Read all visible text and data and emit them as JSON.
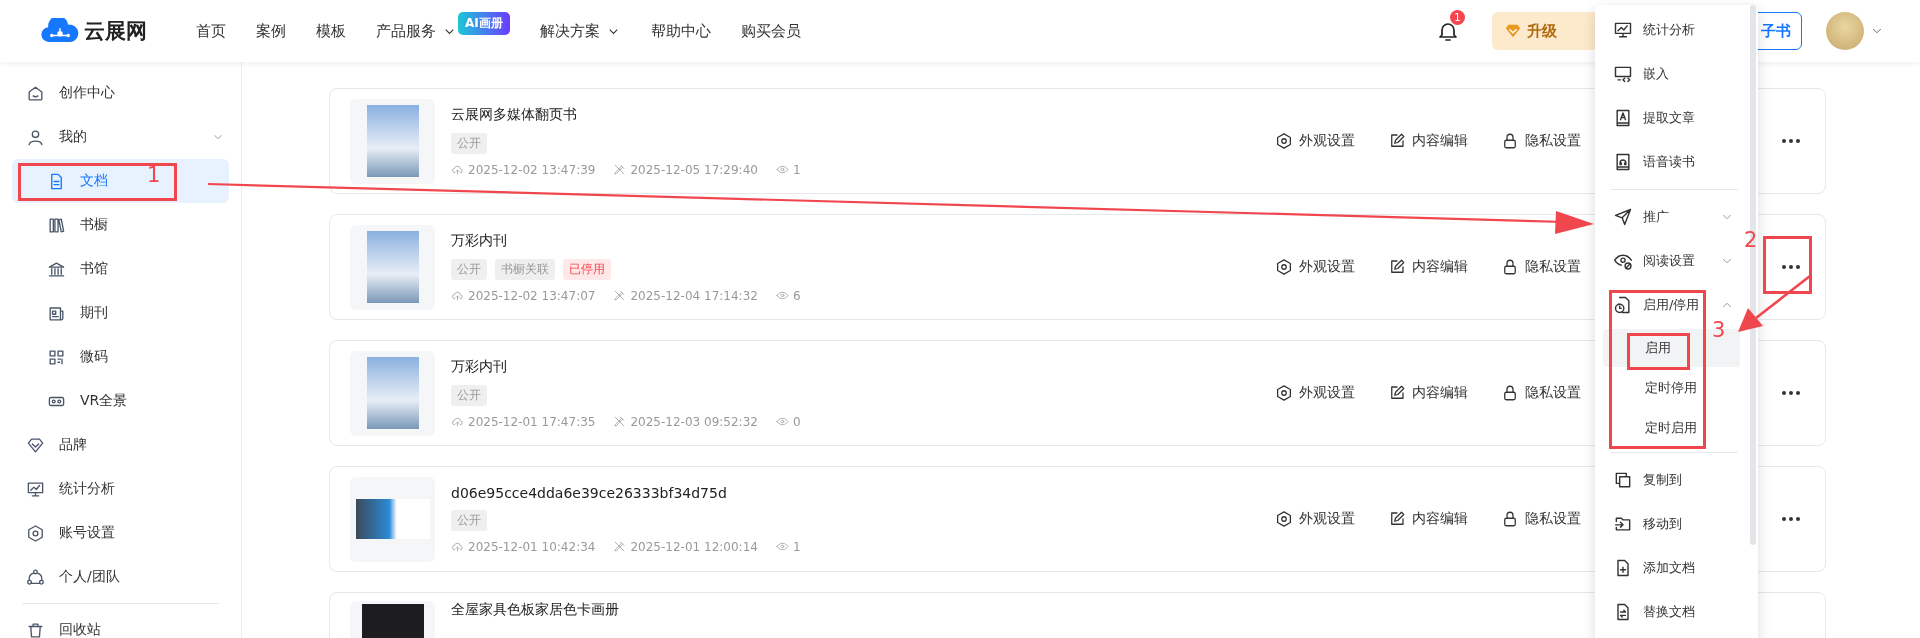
{
  "header": {
    "logo": "云展网",
    "nav": [
      {
        "label": "首页",
        "has_dropdown": false
      },
      {
        "label": "案例",
        "has_dropdown": false
      },
      {
        "label": "模板",
        "has_dropdown": false
      },
      {
        "label": "产品服务",
        "has_dropdown": true,
        "badge": "AI画册"
      },
      {
        "label": "解决方案",
        "has_dropdown": true
      },
      {
        "label": "帮助中心",
        "has_dropdown": false
      },
      {
        "label": "购买会员",
        "has_dropdown": false
      }
    ],
    "notification_count": "1",
    "upgrade_button": "升级",
    "create_button": "子书"
  },
  "sidebar": {
    "items": [
      {
        "label": "创作中心",
        "selected": false
      },
      {
        "label": "我的",
        "selected": false,
        "expanded": true,
        "children": [
          {
            "label": "文档",
            "selected": true
          },
          {
            "label": "书橱",
            "selected": false
          },
          {
            "label": "书馆",
            "selected": false
          },
          {
            "label": "期刊",
            "selected": false
          },
          {
            "label": "微码",
            "selected": false
          },
          {
            "label": "VR全景",
            "selected": false
          }
        ]
      },
      {
        "label": "品牌",
        "selected": false
      },
      {
        "label": "统计分析",
        "selected": false
      },
      {
        "label": "账号设置",
        "selected": false
      },
      {
        "label": "个人/团队",
        "selected": false
      },
      {
        "label": "回收站",
        "selected": false
      }
    ]
  },
  "documents": [
    {
      "title": "云展网多媒体翻页书",
      "tags": [
        {
          "label": "公开",
          "kind": "plain"
        }
      ],
      "created": "2025-12-02 13:47:39",
      "modified": "2025-12-05 17:29:40",
      "views": "1",
      "actions": [
        "外观设置",
        "内容编辑",
        "隐私设置"
      ]
    },
    {
      "title": "万彩内刊",
      "tags": [
        {
          "label": "公开",
          "kind": "plain"
        },
        {
          "label": "书橱关联",
          "kind": "plain"
        },
        {
          "label": "已停用",
          "kind": "alert"
        }
      ],
      "created": "2025-12-02 13:47:07",
      "modified": "2025-12-04 17:14:32",
      "views": "6",
      "actions": [
        "外观设置",
        "内容编辑",
        "隐私设置"
      ]
    },
    {
      "title": "万彩内刊",
      "tags": [
        {
          "label": "公开",
          "kind": "plain"
        }
      ],
      "created": "2025-12-01 17:47:35",
      "modified": "2025-12-03 09:52:32",
      "views": "0",
      "actions": [
        "外观设置",
        "内容编辑",
        "隐私设置"
      ]
    },
    {
      "title": "d06e95cce4dda6e39ce26333bf34d75d",
      "tags": [
        {
          "label": "公开",
          "kind": "plain"
        }
      ],
      "created": "2025-12-01 10:42:34",
      "modified": "2025-12-01 12:00:14",
      "views": "1",
      "actions": [
        "外观设置",
        "内容编辑",
        "隐私设置"
      ]
    },
    {
      "title": "全屋家具色板家居色卡画册"
    }
  ],
  "context_menu": {
    "sections": [
      [
        {
          "label": "统计分析",
          "kind": "action"
        },
        {
          "label": "嵌入",
          "kind": "action"
        },
        {
          "label": "提取文章",
          "kind": "action"
        },
        {
          "label": "语音读书",
          "kind": "action"
        }
      ],
      [
        {
          "label": "推广",
          "kind": "group",
          "expanded": false
        },
        {
          "label": "阅读设置",
          "kind": "group",
          "expanded": false
        },
        {
          "label": "启用/停用",
          "kind": "group",
          "expanded": true,
          "children": [
            {
              "label": "启用",
              "selected": true
            },
            {
              "label": "定时停用",
              "selected": false
            },
            {
              "label": "定时启用",
              "selected": false
            }
          ]
        }
      ],
      [
        {
          "label": "复制到",
          "kind": "action"
        },
        {
          "label": "移动到",
          "kind": "action"
        },
        {
          "label": "添加文档",
          "kind": "action"
        },
        {
          "label": "替换文档",
          "kind": "action"
        }
      ]
    ]
  },
  "annotations": [
    {
      "label": "1"
    },
    {
      "label": "2"
    },
    {
      "label": "3"
    }
  ]
}
